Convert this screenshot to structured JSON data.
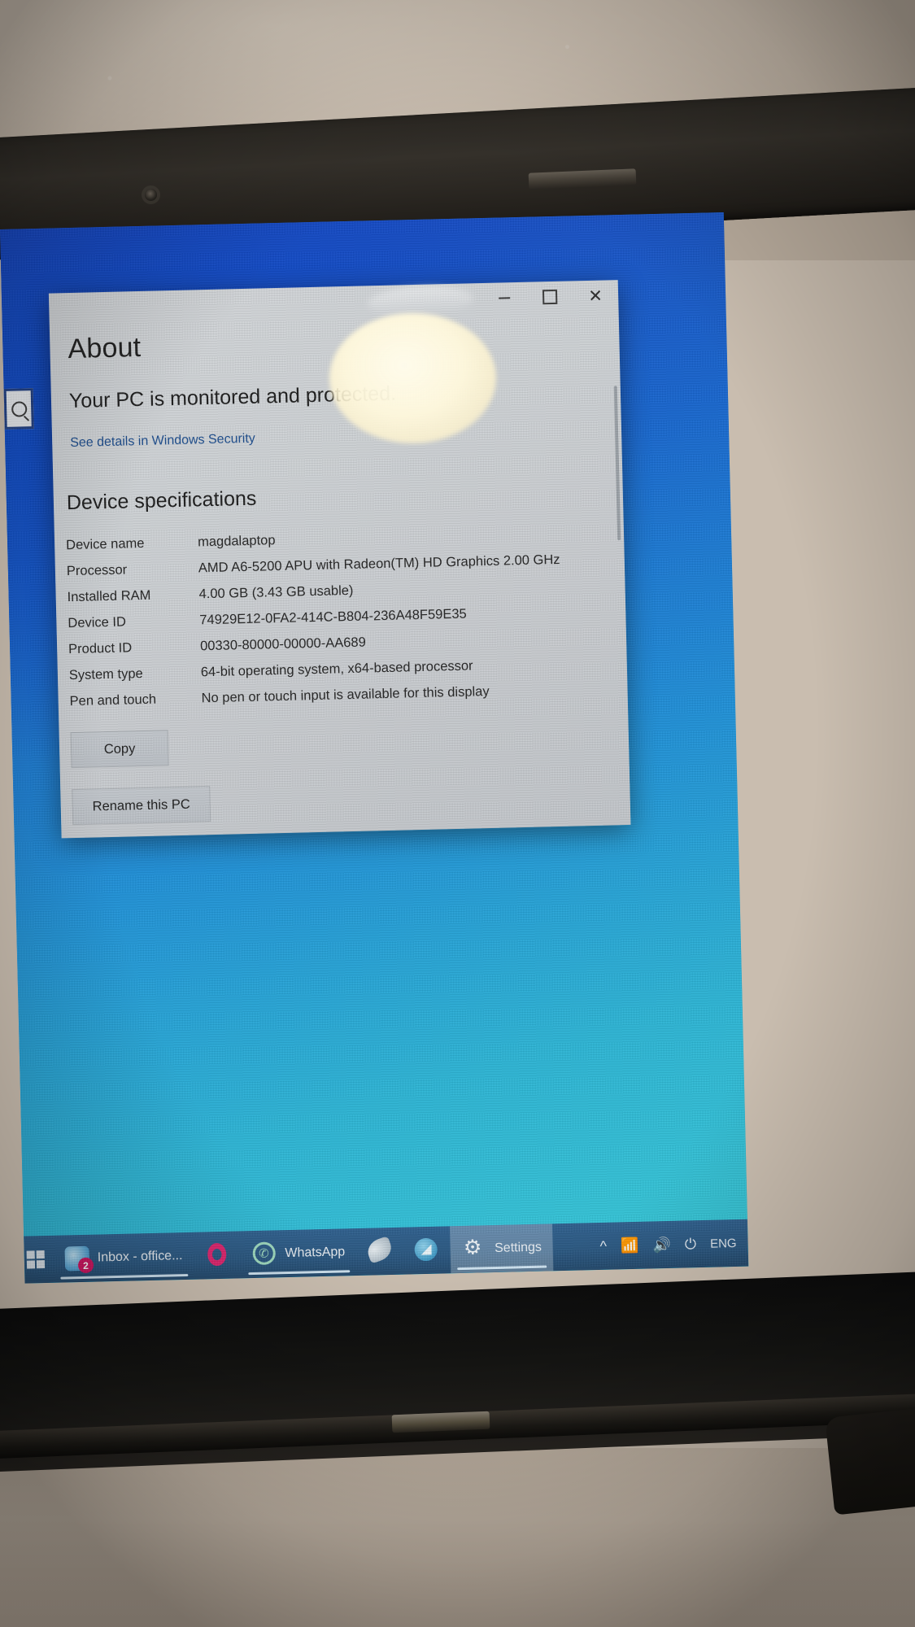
{
  "window": {
    "title": "About",
    "controls": {
      "minimize": "–",
      "maximize": "□",
      "close": "✕"
    },
    "protection_status": "Your PC is monitored and protected.",
    "security_link": "See details in Windows Security",
    "section_heading": "Device specifications",
    "specs": [
      {
        "label": "Device name",
        "value": "magdalaptop"
      },
      {
        "label": "Processor",
        "value": "AMD A6-5200 APU with Radeon(TM) HD Graphics  2.00 GHz"
      },
      {
        "label": "Installed RAM",
        "value": "4.00 GB (3.43 GB usable)"
      },
      {
        "label": "Device ID",
        "value": "74929E12-0FA2-414C-B804-236A48F59E35"
      },
      {
        "label": "Product ID",
        "value": "00330-80000-00000-AA689"
      },
      {
        "label": "System type",
        "value": "64-bit operating system, x64-based processor"
      },
      {
        "label": "Pen and touch",
        "value": "No pen or touch input is available for this display"
      }
    ],
    "copy_button": "Copy",
    "rename_button": "Rename this PC"
  },
  "desktop": {
    "search_icon": "search-icon"
  },
  "taskbar": {
    "start_icon": "windows-logo-icon",
    "items": [
      {
        "icon": "mail-icon",
        "label": "Inbox - office...",
        "badge": "2",
        "active": false,
        "open": true
      },
      {
        "icon": "opera-icon",
        "label": "",
        "badge": "",
        "active": false,
        "open": false
      },
      {
        "icon": "whatsapp-icon",
        "label": "WhatsApp",
        "badge": "",
        "active": false,
        "open": true
      },
      {
        "icon": "feather-icon",
        "label": "",
        "badge": "",
        "active": false,
        "open": false
      },
      {
        "icon": "disc-icon",
        "label": "",
        "badge": "",
        "active": false,
        "open": false
      },
      {
        "icon": "gear-icon",
        "label": "Settings",
        "badge": "",
        "active": true,
        "open": true
      }
    ],
    "tray": {
      "show_hidden": "⌃",
      "wifi": "ᵜ",
      "volume": "ᵜ",
      "battery": "ᵜ",
      "language": "ENG"
    }
  },
  "colors": {
    "accent_blue": "#1a4b8c",
    "taskbar_blue": "#285680",
    "window_gray": "#cfd3d6",
    "badge_pink": "#d1115f",
    "desktop_blue": "#1665cf"
  }
}
